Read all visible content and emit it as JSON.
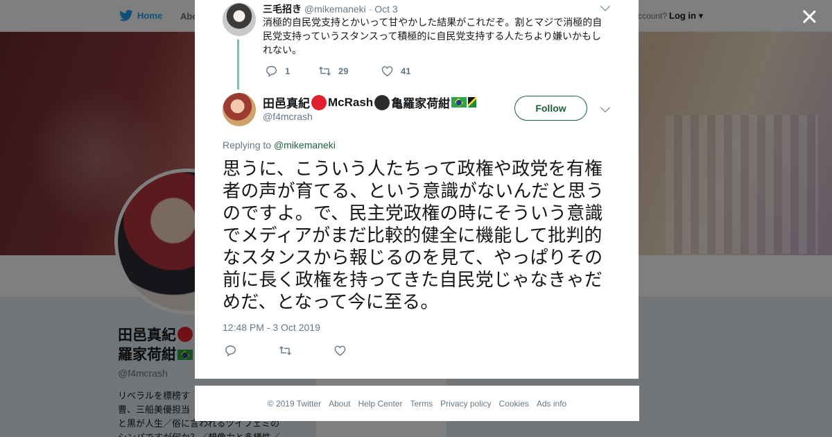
{
  "background": {
    "nav": {
      "home_label": "Home",
      "about_label": "Abo",
      "account_prompt": "ccount?",
      "login_label": "Log in"
    },
    "profile": {
      "name_line1": "田邑真紀",
      "name_line2": "羅家荷紺",
      "handle": "@f4mcrash",
      "bio_lines": [
        "リベラルを標榜す",
        "曹、三船美優担当",
        "と黒が人生／俗に言われるツイフェミの",
        "シンパですが何か？／想像力と多様性／"
      ]
    }
  },
  "modal": {
    "parent_tweet": {
      "name": "三毛招き",
      "handle": "@mikemaneki",
      "separator": "·",
      "date": "Oct 3",
      "text": "消極的自民党支持とかいって甘やかした結果がこれだぞ。割とマジで消極的自民党支持っていうスタンスって積極的に自民党支持する人たちより嫌いかもしれない。",
      "reply_count": "1",
      "retweet_count": "29",
      "like_count": "41"
    },
    "main_tweet": {
      "name_part1": "田邑真紀",
      "name_part2": "McRash",
      "name_part3": "亀羅家荷紺",
      "handle": "@f4mcrash",
      "follow_label": "Follow",
      "replying_prefix": "Replying to",
      "replying_to": "@mikemaneki",
      "text": "思うに、こういう人たちって政権や政党を有権者の声が育てる、という意識がないんだと思うのですよ。で、民主党政権の時にそういう意識でメディアがまだ比較的健全に機能して批判的なスタンスから報じるのを見て、やっぱりその前に長く政権を持ってきた自民党じゃなきゃだめだ、となって今に至る。",
      "timestamp": "12:48 PM - 3 Oct 2019"
    }
  },
  "footer": {
    "copyright": "© 2019 Twitter",
    "links": [
      "About",
      "Help Center",
      "Terms",
      "Privacy policy",
      "Cookies",
      "Ads info"
    ]
  },
  "colors": {
    "accent_green": "#1c5f3f",
    "twitter_blue": "#1da1f2",
    "muted_text": "#657786",
    "red_circle": "#e0202e",
    "black_circle": "#222222"
  },
  "icons": [
    "twitter-bird-icon",
    "close-icon",
    "chevron-down-icon",
    "reply-icon",
    "retweet-icon",
    "like-icon"
  ]
}
